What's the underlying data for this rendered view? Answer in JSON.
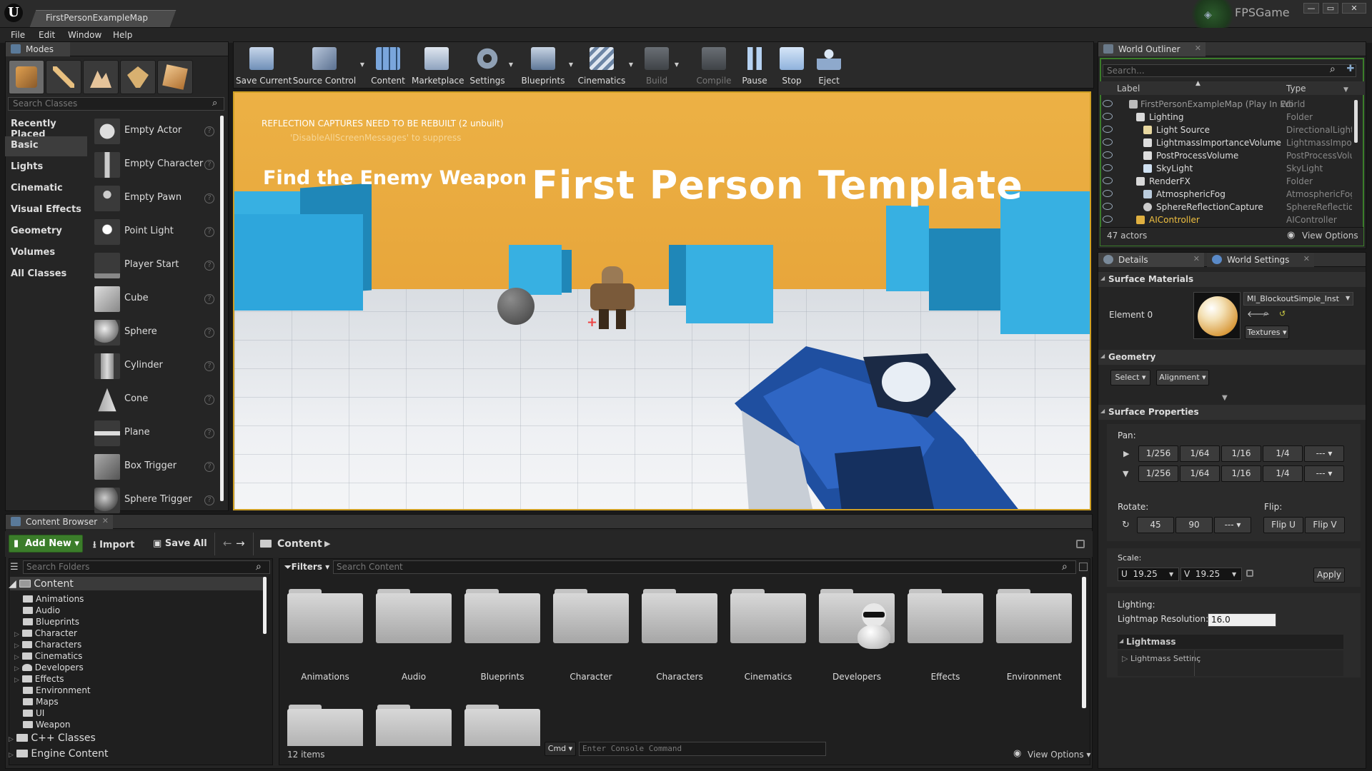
{
  "titlebar": {
    "map_tab": "FirstPersonExampleMap",
    "project": "FPSGame",
    "window_buttons": [
      "—",
      "▭",
      "✕"
    ]
  },
  "menu": [
    "File",
    "Edit",
    "Window",
    "Help"
  ],
  "modes": {
    "title": "Modes",
    "search_placeholder": "Search Classes",
    "categories": [
      "Recently Placed",
      "Basic",
      "Lights",
      "Cinematic",
      "Visual Effects",
      "Geometry",
      "Volumes",
      "All Classes"
    ],
    "selected_category": "Basic",
    "items": [
      "Empty Actor",
      "Empty Character",
      "Empty Pawn",
      "Point Light",
      "Player Start",
      "Cube",
      "Sphere",
      "Cylinder",
      "Cone",
      "Plane",
      "Box Trigger",
      "Sphere Trigger"
    ],
    "help_glyph": "?"
  },
  "toolbar": {
    "buttons": [
      {
        "label": "Save Current",
        "icon": "save-icon",
        "color": "#8fa6c4"
      },
      {
        "label": "Source Control",
        "icon": "source-control-icon",
        "color": "#7c92b5"
      },
      {
        "label": "Content",
        "icon": "content-icon",
        "color": "#6a95cc"
      },
      {
        "label": "Marketplace",
        "icon": "marketplace-icon",
        "color": "#9fb2cf"
      },
      {
        "label": "Settings",
        "icon": "settings-icon",
        "color": "#8899aa"
      },
      {
        "label": "Blueprints",
        "icon": "blueprints-icon",
        "color": "#8fa9c9"
      },
      {
        "label": "Cinematics",
        "icon": "cinematics-icon",
        "color": "#9db0c8"
      },
      {
        "label": "Build",
        "icon": "build-icon",
        "color": "#555b63"
      },
      {
        "label": "Compile",
        "icon": "compile-icon",
        "color": "#555b63"
      },
      {
        "label": "Pause",
        "icon": "pause-icon",
        "color": "#8fb4e2"
      },
      {
        "label": "Stop",
        "icon": "stop-icon",
        "color": "#9fc0e8"
      },
      {
        "label": "Eject",
        "icon": "eject-icon",
        "color": "#9fb7d8"
      }
    ]
  },
  "viewport": {
    "message": "REFLECTION CAPTURES NEED TO BE REBUILT (2 unbuilt)",
    "message_hint": "'DisableAllScreenMessages' to suppress",
    "objective": "Find the Enemy Weapon",
    "wall_title": "First Person Template",
    "crosshair": "+"
  },
  "outliner": {
    "title": "World Outliner",
    "search_placeholder": "Search...",
    "col_label": "Label",
    "col_type": "Type",
    "rows": [
      {
        "name": "FirstPersonExampleMap (Play In Edi",
        "type": "World",
        "indent": 0
      },
      {
        "name": "Lighting",
        "type": "Folder",
        "indent": 1
      },
      {
        "name": "Light Source",
        "type": "DirectionalLight",
        "indent": 2
      },
      {
        "name": "LightmassImportanceVolume",
        "type": "LightmassImporta",
        "indent": 2
      },
      {
        "name": "PostProcessVolume",
        "type": "PostProcessVolu",
        "indent": 2
      },
      {
        "name": "SkyLight",
        "type": "SkyLight",
        "indent": 2
      },
      {
        "name": "RenderFX",
        "type": "Folder",
        "indent": 1
      },
      {
        "name": "AtmosphericFog",
        "type": "AtmosphericFog",
        "indent": 2
      },
      {
        "name": "SphereReflectionCapture",
        "type": "SphereReflection(",
        "indent": 2
      },
      {
        "name": "AIController",
        "type": "AIController",
        "indent": 1
      }
    ],
    "actor_count": "47 actors",
    "view_options": "View Options"
  },
  "details": {
    "tabs": [
      "Details",
      "World Settings"
    ],
    "surface_materials": {
      "title": "Surface Materials",
      "element": "Element 0",
      "material": "MI_BlockoutSimple_Inst",
      "textures_btn": "Textures"
    },
    "geometry": {
      "title": "Geometry",
      "select_btn": "Select",
      "alignment_btn": "Alignment"
    },
    "surface_properties": {
      "title": "Surface Properties",
      "pan_label": "Pan:",
      "pan_values": [
        "1/256",
        "1/64",
        "1/16",
        "1/4",
        "---"
      ],
      "rotate_label": "Rotate:",
      "rotate_values": [
        "45",
        "90",
        "---"
      ],
      "flip_label": "Flip:",
      "flip_u": "Flip U",
      "flip_v": "Flip V",
      "scale_label": "Scale:",
      "scale_u_prefix": "U",
      "scale_u": "19.25",
      "scale_v_prefix": "V",
      "scale_v": "19.25",
      "apply": "Apply",
      "lighting_label": "Lighting:",
      "lightmap_label": "Lightmap Resolution:",
      "lightmap_value": "16.0",
      "lightmass": "Lightmass",
      "lightmass_settings": "Lightmass Settinç"
    }
  },
  "content_browser": {
    "title": "Content Browser",
    "add_new": "Add New",
    "import": "Import",
    "save_all": "Save All",
    "path": "Content",
    "search_folders": "Search Folders",
    "filters": "Filters",
    "search_content": "Search Content",
    "tree": [
      {
        "name": "Content",
        "level": 0,
        "open": true
      },
      {
        "name": "Animations",
        "level": 1
      },
      {
        "name": "Audio",
        "level": 1
      },
      {
        "name": "Blueprints",
        "level": 1
      },
      {
        "name": "Character",
        "level": 1,
        "arrow": true
      },
      {
        "name": "Characters",
        "level": 1,
        "arrow": true
      },
      {
        "name": "Cinematics",
        "level": 1,
        "arrow": true
      },
      {
        "name": "Developers",
        "level": 1,
        "arrow": true
      },
      {
        "name": "Effects",
        "level": 1,
        "arrow": true
      },
      {
        "name": "Environment",
        "level": 1
      },
      {
        "name": "Maps",
        "level": 1
      },
      {
        "name": "UI",
        "level": 1
      },
      {
        "name": "Weapon",
        "level": 1
      },
      {
        "name": "C++ Classes",
        "level": 0,
        "arrow": true
      },
      {
        "name": "Engine Content",
        "level": 0,
        "arrow": true
      }
    ],
    "assets": [
      "Animations",
      "Audio",
      "Blueprints",
      "Character",
      "Characters",
      "Cinematics",
      "Developers",
      "Effects",
      "Environment"
    ],
    "item_count": "12 items",
    "cmd": "Cmd",
    "console_placeholder": "Enter Console Command",
    "view_options": "View Options"
  }
}
